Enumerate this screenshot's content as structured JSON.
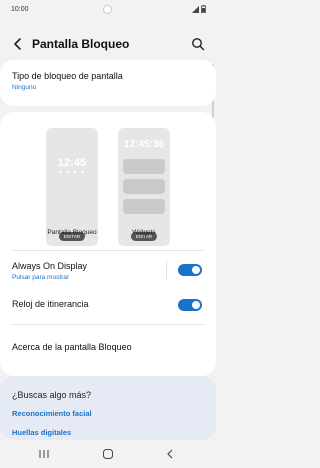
{
  "status_bar": {
    "time": "10:00"
  },
  "header": {
    "title": "Pantalla Bloqueo"
  },
  "lock_type": {
    "title": "Tipo de bloqueo de pantalla",
    "value": "Ninguno"
  },
  "previews": {
    "lock_label": "Pantalla Bloqueo",
    "lock_time": "12:45",
    "lock_dots": "● ● ● ●",
    "widgets_label": "Widgets",
    "widgets_time": "12:45:36",
    "edit_label": "EDITAR"
  },
  "always_on": {
    "title": "Always On Display",
    "subtitle": "Pulsar para mostrar",
    "enabled": true
  },
  "roaming_clock": {
    "title": "Reloj de itinerancia",
    "enabled": true
  },
  "about": {
    "title": "Acerca de la pantalla Bloqueo"
  },
  "more": {
    "heading": "¿Buscas algo más?",
    "links": [
      "Reconocimiento facial",
      "Huellas digitales"
    ]
  },
  "colors": {
    "accent": "#1a73c8",
    "background": "#f2f2f2",
    "card": "#ffffff"
  }
}
